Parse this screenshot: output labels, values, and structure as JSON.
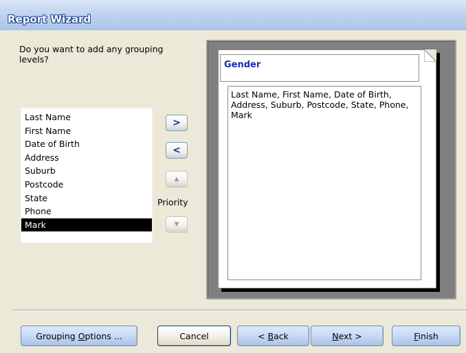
{
  "window": {
    "title": "Report Wizard"
  },
  "question": "Do you want to add any grouping levels?",
  "field_list": {
    "items": [
      "Last Name",
      "First Name",
      "Date of Birth",
      "Address",
      "Suburb",
      "Postcode",
      "State",
      "Phone",
      "Mark"
    ],
    "selected": "Mark"
  },
  "arrow_buttons": {
    "add": ">",
    "remove": "<",
    "priority_up": "▲",
    "priority_down": "▼",
    "priority_label": "Priority"
  },
  "preview": {
    "group_label": "Gender",
    "detail_fields": "Last Name, First Name, Date of Birth, Address, Suburb, Postcode, State, Phone, Mark"
  },
  "buttons": {
    "grouping_options": {
      "pre": "Grouping ",
      "u": "O",
      "post": "ptions ..."
    },
    "cancel": {
      "pre": "Cancel",
      "u": "",
      "post": ""
    },
    "back": {
      "pre": "< ",
      "u": "B",
      "post": "ack"
    },
    "next": {
      "pre": "",
      "u": "N",
      "post": "ext >"
    },
    "finish": {
      "pre": "",
      "u": "F",
      "post": "inish"
    }
  },
  "colors": {
    "title_text": "#ffffff",
    "group_label": "#1a2ea8",
    "selection": "#000000"
  }
}
